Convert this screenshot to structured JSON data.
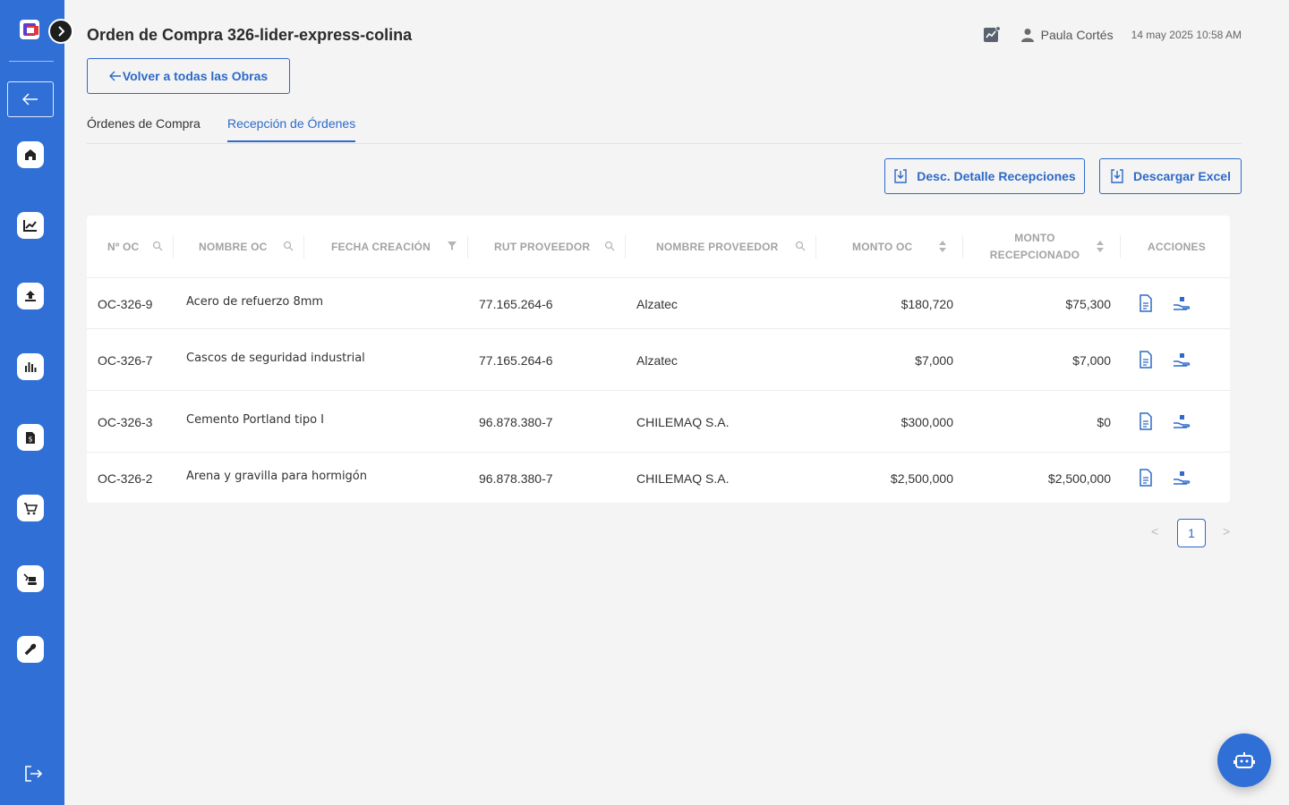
{
  "app": {
    "title": "Orden de Compra 326-lider-express-colina",
    "user_name": "Paula Cortés",
    "datetime": "14 may 2025 10:58 AM",
    "back_label": "Volver a todas las Obras"
  },
  "sidebar": {
    "items": [
      {
        "icon": "home-icon"
      },
      {
        "icon": "chart-line-icon"
      },
      {
        "icon": "upload-icon"
      },
      {
        "icon": "bar-chart-icon"
      },
      {
        "icon": "invoice-icon"
      },
      {
        "icon": "cart-icon"
      },
      {
        "icon": "excavator-icon"
      },
      {
        "icon": "wrench-icon"
      }
    ]
  },
  "tabs": [
    {
      "label": "Órdenes de Compra",
      "active": false
    },
    {
      "label": "Recepción de Órdenes",
      "active": true
    }
  ],
  "actions": {
    "download_details": "Desc. Detalle Recepciones",
    "download_excel": "Descargar Excel"
  },
  "table": {
    "headers": {
      "oc": "Nº OC",
      "name": "NOMBRE OC",
      "date": "FECHA CREACIÓN",
      "rut": "RUT PROVEEDOR",
      "provider": "NOMBRE PROVEEDOR",
      "amount": "MONTO OC",
      "received": "MONTO RECEPCIONADO",
      "actions": "ACCIONES"
    },
    "rows": [
      {
        "oc": "OC-326-9",
        "name": "Acero de refuerzo 8mm",
        "rut": "77.165.264-6",
        "provider": "Alzatec",
        "amount": "$180,720",
        "received": "$75,300"
      },
      {
        "oc": "OC-326-7",
        "name": "Cascos de seguridad industrial",
        "rut": "77.165.264-6",
        "provider": "Alzatec",
        "amount": "$7,000",
        "received": "$7,000"
      },
      {
        "oc": "OC-326-3",
        "name": "Cemento Portland tipo I",
        "rut": "96.878.380-7",
        "provider": "CHILEMAQ S.A.",
        "amount": "$300,000",
        "received": "$0"
      },
      {
        "oc": "OC-326-2",
        "name": "Arena y gravilla para hormigón",
        "rut": "96.878.380-7",
        "provider": "CHILEMAQ S.A.",
        "amount": "$2,500,000",
        "received": "$2,500,000"
      }
    ]
  },
  "pagination": {
    "current": "1",
    "prev": "<",
    "next": ">"
  },
  "colors": {
    "primary": "#2f6fd6",
    "accent": "#2d6ac9"
  }
}
